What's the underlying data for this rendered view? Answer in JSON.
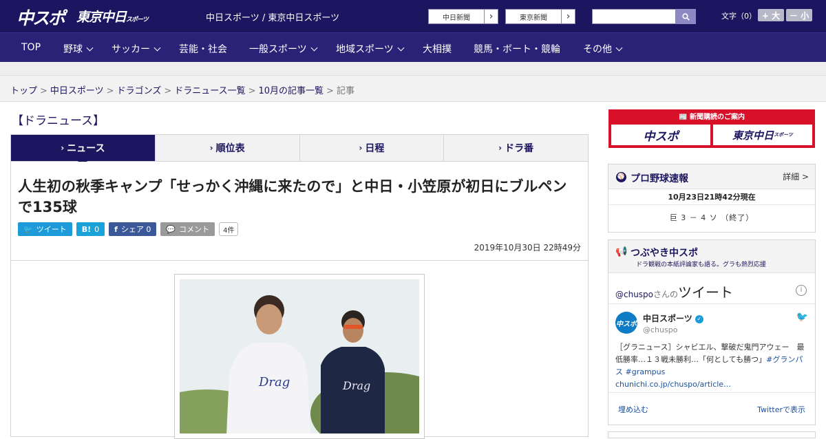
{
  "header": {
    "logo_chuspo": "中スポ",
    "logo_tokyo": "東京中日",
    "logo_tokyo_small": "スポーツ",
    "site_title": "中日スポーツ / 東京中日スポーツ",
    "link_chunichi": "中日新聞",
    "link_tokyo": "東京新聞",
    "search_placeholder": "",
    "font_size_label": "文字（0）",
    "font_larger": "+ 大",
    "font_smaller": "－ 小",
    "brand_color": "#1c1560"
  },
  "nav": {
    "items": [
      {
        "label": "TOP"
      },
      {
        "label": "野球"
      },
      {
        "label": "サッカー"
      },
      {
        "label": "芸能・社会"
      },
      {
        "label": "一般スポーツ"
      },
      {
        "label": "地域スポーツ"
      },
      {
        "label": "大相撲"
      },
      {
        "label": "競馬・ボート・競輪"
      },
      {
        "label": "その他"
      }
    ]
  },
  "breadcrumb": {
    "items": [
      "トップ",
      "中日スポーツ",
      "ドラゴンズ",
      "ドラニュース一覧",
      "10月の記事一覧"
    ],
    "current": "記事",
    "separator": ">"
  },
  "section": {
    "title": "【ドラニュース】"
  },
  "tabs": [
    {
      "label": "ニュース",
      "active": true
    },
    {
      "label": "順位表",
      "active": false
    },
    {
      "label": "日程",
      "active": false
    },
    {
      "label": "ドラ番",
      "active": false
    }
  ],
  "article": {
    "headline": "人生初の秋季キャンプ「せっかく沖縄に来たので」と中日・小笠原が初日にブルペンで135球",
    "share": {
      "tweet": "ツイート",
      "hatena_icon": "B!",
      "hatena_count": "0",
      "facebook": "シェア",
      "facebook_count": "0",
      "comment": "コメント",
      "comment_count": "4件"
    },
    "published": "2019年10月30日 22時49分"
  },
  "sidebar": {
    "subscribe": {
      "title": "新聞購読のご案内",
      "item1": "中スポ",
      "item2": "東京中日",
      "item2_small": "スポーツ"
    },
    "baseball": {
      "title": "プロ野球速報",
      "more": "詳細 >",
      "time": "10月23日21時42分現在",
      "score": "巨 3 － 4 ソ （終了）"
    },
    "tweets": {
      "title": "つぶやき中スポ",
      "subtitle": "ドラ観戦の本紙評論家も語る。グラも熱烈応援",
      "handle_link": "@chuspo",
      "by": "さんの",
      "header_big": "ツイート",
      "account_name": "中日スポーツ",
      "account_handle": "@chuspo",
      "body_text": "［グラニュース］シャビエル、撃破だ鬼門アウェー　最低勝率…１３戦未勝利…「何としても勝つ」",
      "body_tags": "#グランパス #grampus",
      "body_link": "chunichi.co.jp/chuspo/article…",
      "embed": "埋め込む",
      "view_on_twitter": "Twitterで表示"
    }
  }
}
